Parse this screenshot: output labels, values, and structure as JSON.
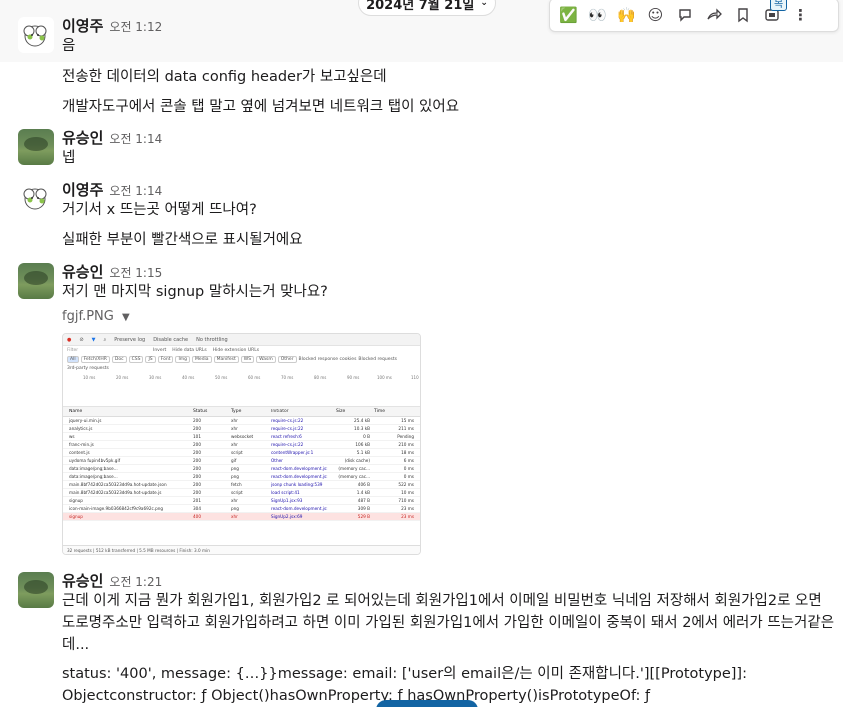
{
  "date_divider": {
    "label": "2024년 7월 21일"
  },
  "hover_toolbar": {
    "badge": "목",
    "buttons": [
      {
        "icon": "check-mark-icon",
        "glyph": "✅"
      },
      {
        "icon": "eyes-icon",
        "glyph": "👀"
      },
      {
        "icon": "raised-hands-icon",
        "glyph": "🙌"
      },
      {
        "icon": "add-reaction-icon",
        "glyph": "☺"
      },
      {
        "icon": "reply-thread-icon",
        "glyph": "💬"
      },
      {
        "icon": "share-icon",
        "glyph": "➦"
      },
      {
        "icon": "bookmark-icon",
        "glyph": "🔖"
      },
      {
        "icon": "apps-icon",
        "glyph": "▣"
      },
      {
        "icon": "more-icon",
        "glyph": "⋮"
      }
    ]
  },
  "messages": [
    {
      "author": "이영주",
      "time": "오전 1:12",
      "lines": [
        "음",
        "전송한 데이터의 data config header가 보고싶은데",
        "개발자도구에서 콘솔 탭 말고 옆에 넘겨보면 네트워크 탭이 있어요"
      ]
    },
    {
      "author": "유승인",
      "time": "오전 1:14",
      "lines": [
        "넵"
      ]
    },
    {
      "author": "이영주",
      "time": "오전 1:14",
      "lines": [
        "거기서 x 뜨는곳 어떻게 뜨나여?",
        "실패한 부분이 빨간색으로 표시될거에요"
      ]
    },
    {
      "author": "유승인",
      "time": "오전 1:15",
      "lines": [
        "저기 맨 마지막 signup 말하시는거 맞나요?"
      ],
      "file": "fgjf.PNG"
    },
    {
      "author": "유승인",
      "time": "오전 1:21",
      "lines": [
        "근데 이게 지금 뭔가 회원가입1, 회원가입2 로 되어있는데 회원가입1에서 이메일 비밀번호 닉네임 저장해서 회원가입2로 오면 도로명주소만 입력하고 회원가입하려고 하면 이미 가입된 회원가입1에서 가입한 이메일이 중복이 돼서 2에서 에러가 뜨는거같은데...",
        "status: '400', message: {…}}message: email: ['user의 email은/는 이미 존재합니다.'][[Prototype]]: Objectconstructor: ƒ Object()hasOwnProperty: ƒ hasOwnProperty()isPrototypeOf: ƒ isPrototypeOf()propertyIsEnumerable: ƒ"
      ]
    }
  ],
  "devtools": {
    "toolbar": [
      "Preserve log",
      "Disable cache",
      "No throttling"
    ],
    "filter_placeholder": "Filter",
    "filter_options": [
      "Invert",
      "Hide data URLs",
      "Hide extension URLs"
    ],
    "type_chips": [
      "All",
      "Fetch/XHR",
      "Doc",
      "CSS",
      "JS",
      "Font",
      "Img",
      "Media",
      "Manifest",
      "WS",
      "Wasm",
      "Other"
    ],
    "blocked": [
      "Blocked response cookies",
      "Blocked requests"
    ],
    "third_party": "3rd-party requests",
    "timeline_ticks": [
      "10 ms",
      "20 ms",
      "30 ms",
      "40 ms",
      "50 ms",
      "60 ms",
      "70 ms",
      "80 ms",
      "90 ms",
      "100 ms",
      "110"
    ],
    "columns": [
      "Name",
      "Status",
      "Type",
      "Initiator",
      "Size",
      "Time"
    ],
    "rows": [
      [
        "jquery-ui.min.js",
        "200",
        "xhr",
        "require-cs.js:22",
        "25.4 kB",
        "15 ms"
      ],
      [
        "analytics.js",
        "200",
        "xhr",
        "require-cs.js:22",
        "10.3 kB",
        "211 ms"
      ],
      [
        "ws",
        "101",
        "websocket",
        "react refresh:6",
        "0 B",
        "Pending"
      ],
      [
        "franc-min.js",
        "200",
        "xhr",
        "require-cs.js:22",
        "106 kB",
        "210 ms"
      ],
      [
        "content.js",
        "200",
        "script",
        "contentWrapper.js:1",
        "5.1 kB",
        "18 ms"
      ],
      [
        "uydoma fupin4bv5pk.gif",
        "200",
        "gif",
        "Other",
        "(disk cache)",
        "6 ms"
      ],
      [
        "data:image/png;base...",
        "200",
        "png",
        "react-dom.development.js:",
        "(memory cac...",
        "0 ms"
      ],
      [
        "data:image/png;base...",
        "200",
        "png",
        "react-dom.development.js:",
        "(memory cac...",
        "0 ms"
      ],
      [
        "main.8bf742d02ca50323dd9a.hot-update.json",
        "200",
        "fetch",
        "jsonp chunk loading:539",
        "406 B",
        "522 ms"
      ],
      [
        "main.8bf742d02ca50323dd9a.hot-update.js",
        "200",
        "script",
        "load script:41",
        "1.4 kB",
        "10 ms"
      ],
      [
        "signup",
        "201",
        "xhr",
        "SignUp1.jsx:93",
        "487 B",
        "710 ms"
      ],
      [
        "icon-main-image.9b0366842cf9c9a692c.png",
        "304",
        "png",
        "react-dom.development.js:",
        "309 B",
        "23 ms"
      ],
      [
        "signup",
        "400",
        "xhr",
        "SignUp2.jsx:69",
        "529 B",
        "23 ms"
      ]
    ],
    "footer": "32 requests  |  512 kB transferred  |  5.5 MB resources  |  Finish: 3.0 min"
  }
}
